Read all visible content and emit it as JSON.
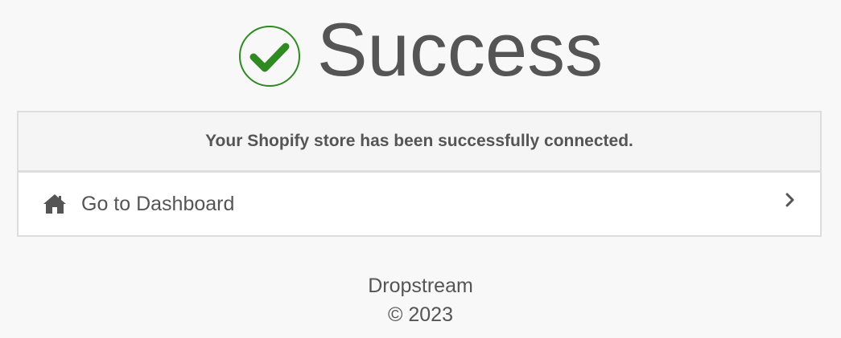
{
  "header": {
    "icon": "check-circle-icon",
    "title": "Success",
    "icon_color": "#2f8a22"
  },
  "panel": {
    "message": "Your Shopify store has been successfully connected.",
    "dashboard_link": {
      "icon": "home-icon",
      "label": "Go to Dashboard",
      "chevron": "chevron-right-icon"
    }
  },
  "footer": {
    "company": "Dropstream",
    "copyright": "© 2023"
  },
  "colors": {
    "background": "#f8f8f8",
    "text": "#555555",
    "border": "#dddddd",
    "success": "#2f8a22"
  }
}
